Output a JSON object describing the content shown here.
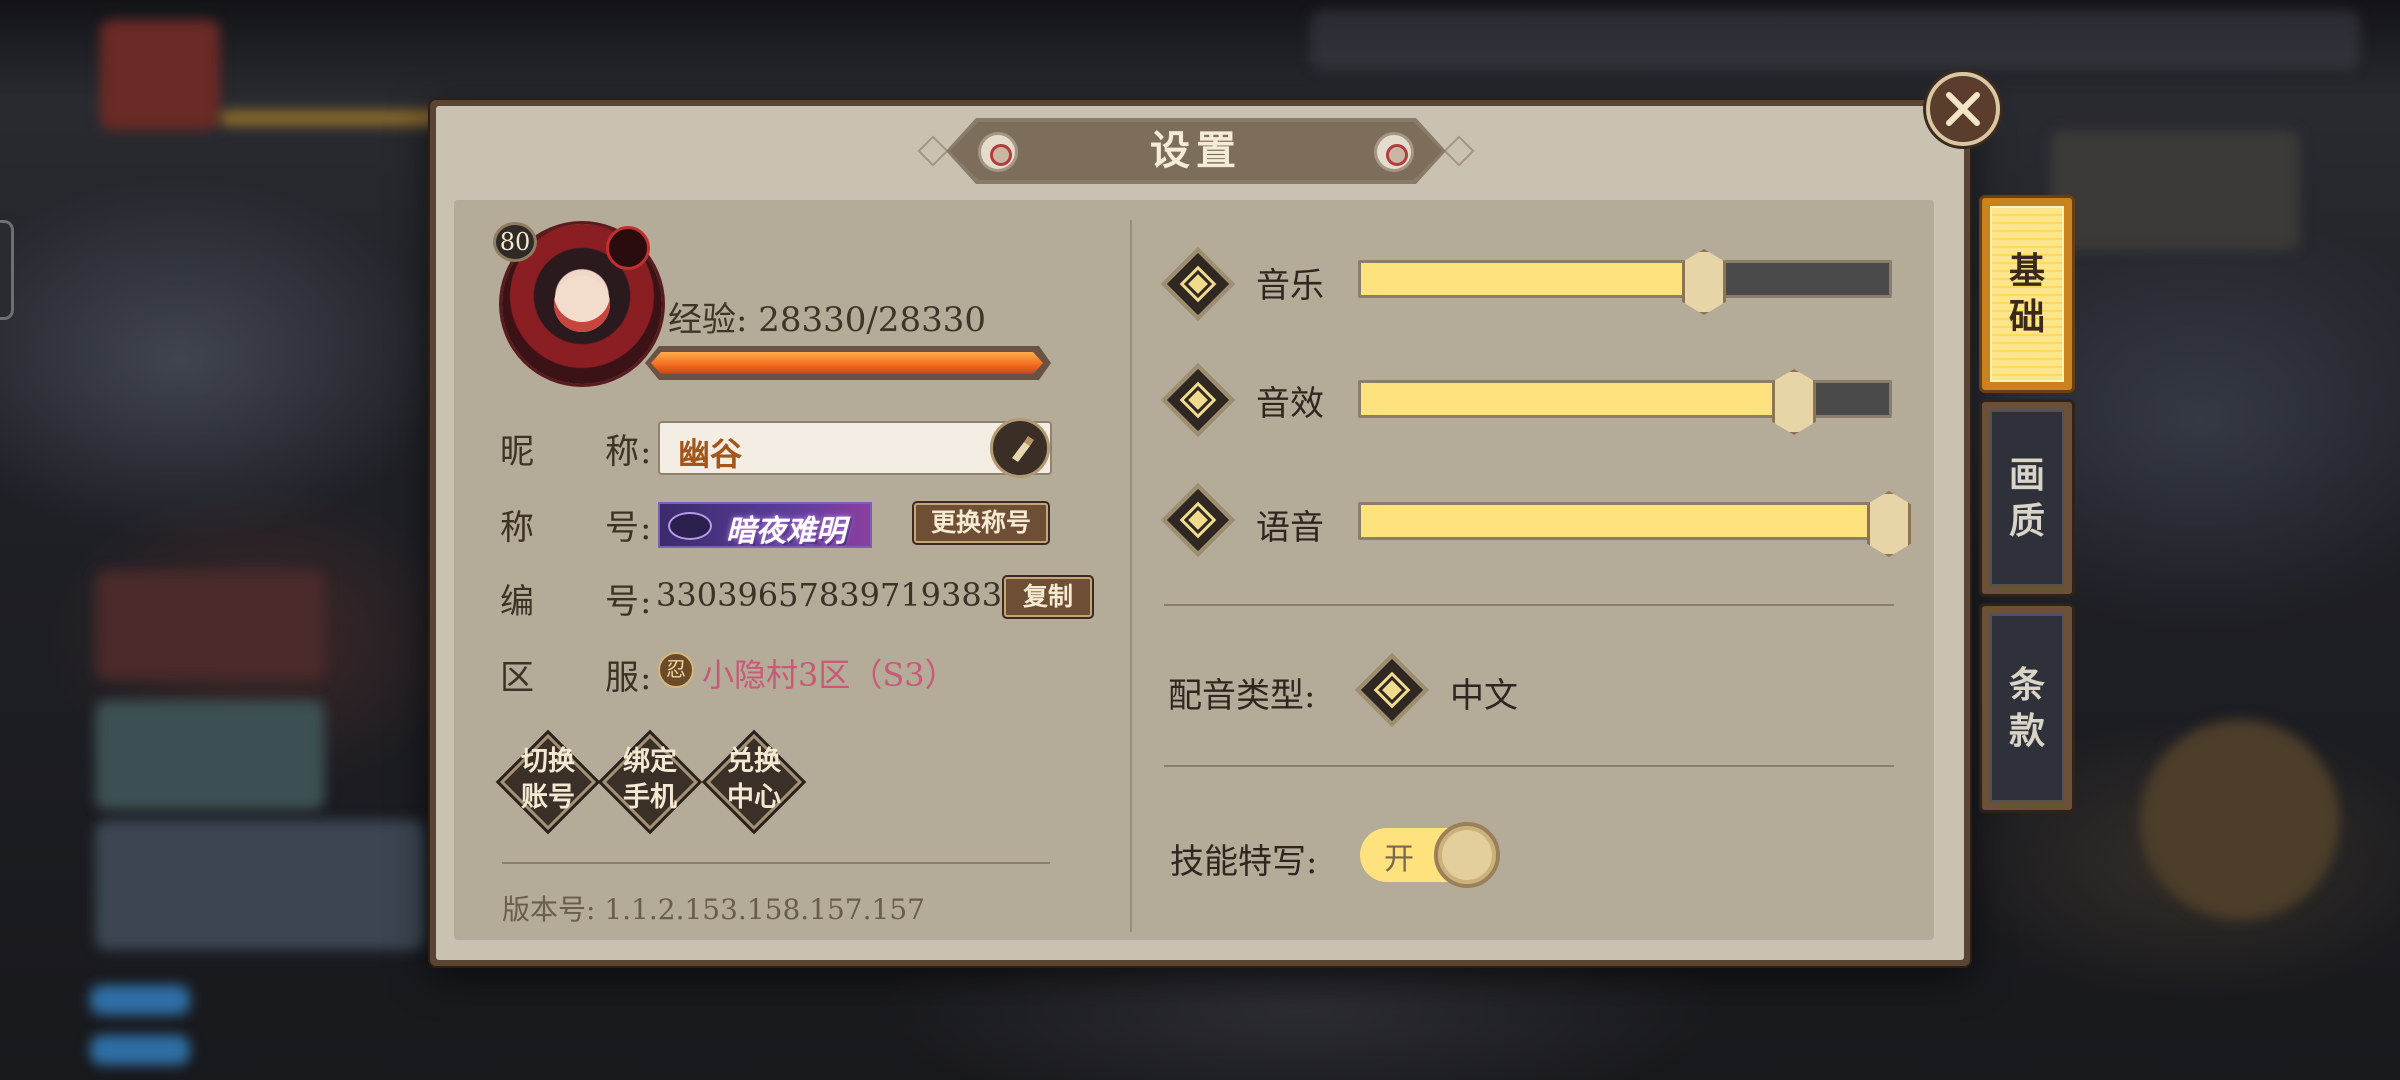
{
  "dialog": {
    "title": "设置",
    "close_icon": "close-icon"
  },
  "profile": {
    "level": "80",
    "exp_label": "经验: 28330/28330",
    "exp_fraction": 1.0,
    "nickname_label": "昵　　称:",
    "nickname": "幽谷",
    "title_label": "称　　号:",
    "title_badge": "暗夜难明",
    "change_title_button": "更换称号",
    "id_label": "编　　号:",
    "id_value": "3303965783971938304",
    "copy_button": "复制",
    "server_label": "区　　服:",
    "server_icon_glyph": "忍",
    "server_value": "小隐村3区（S3）",
    "version": "版本号: 1.1.2.153.158.157.157"
  },
  "account_buttons": [
    {
      "line1": "切换",
      "line2": "账号"
    },
    {
      "line1": "绑定",
      "line2": "手机"
    },
    {
      "line1": "兑换",
      "line2": "中心"
    }
  ],
  "settings": {
    "music_label": "音乐",
    "music_level": 0.65,
    "sfx_label": "音效",
    "sfx_level": 0.82,
    "voice_label": "语音",
    "voice_level": 1.0,
    "voice_type_label": "配音类型:",
    "voice_type_value": "中文",
    "skill_closeup_label": "技能特写:",
    "skill_closeup_toggle": "开"
  },
  "tabs": [
    {
      "line1": "基",
      "line2": "础",
      "active": true
    },
    {
      "line1": "画",
      "line2": "质",
      "active": false
    },
    {
      "line1": "条",
      "line2": "款",
      "active": false
    }
  ],
  "colors": {
    "slider_fill": "#fde27e",
    "exp_fill": "#f26a1f",
    "server_text": "#c85a78",
    "nickname_text": "#a3561b"
  }
}
